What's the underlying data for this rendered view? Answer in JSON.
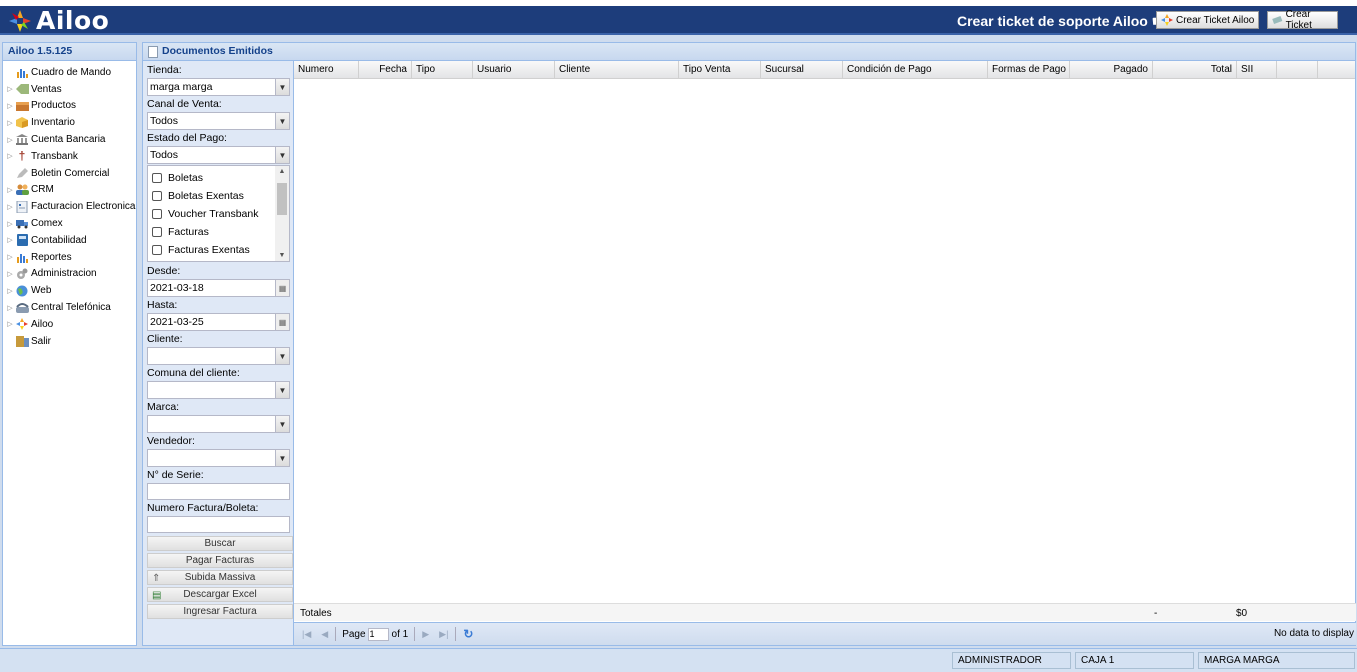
{
  "app": {
    "name": "Ailoo",
    "version_label": "Ailoo 1.5.125"
  },
  "header": {
    "support_text": "Crear ticket de soporte Ailoo ☛",
    "btn_ticket_ailoo": "Crear Ticket Ailoo",
    "btn_ticket": "Crear Ticket"
  },
  "sidebar": {
    "items": [
      {
        "label": "Cuadro de Mando",
        "icon": "bar-chart-icon",
        "expandable": false
      },
      {
        "label": "Ventas",
        "icon": "tag-icon",
        "expandable": true
      },
      {
        "label": "Productos",
        "icon": "box-icon",
        "expandable": true
      },
      {
        "label": "Inventario",
        "icon": "package-icon",
        "expandable": true
      },
      {
        "label": "Cuenta Bancaria",
        "icon": "bank-icon",
        "expandable": true
      },
      {
        "label": "Transbank",
        "icon": "cross-icon",
        "expandable": true
      },
      {
        "label": "Boletin Comercial",
        "icon": "pencil-icon",
        "expandable": false
      },
      {
        "label": "CRM",
        "icon": "users-icon",
        "expandable": true
      },
      {
        "label": "Facturacion Electronica",
        "icon": "document-icon",
        "expandable": true
      },
      {
        "label": "Comex",
        "icon": "truck-icon",
        "expandable": true
      },
      {
        "label": "Contabilidad",
        "icon": "calculator-icon",
        "expandable": true
      },
      {
        "label": "Reportes",
        "icon": "report-chart-icon",
        "expandable": true
      },
      {
        "label": "Administracion",
        "icon": "gears-icon",
        "expandable": true
      },
      {
        "label": "Web",
        "icon": "globe-icon",
        "expandable": true
      },
      {
        "label": "Central Telefónica",
        "icon": "phone-icon",
        "expandable": true
      },
      {
        "label": "Ailoo",
        "icon": "ailoo-logo-icon",
        "expandable": true
      },
      {
        "label": "Salir",
        "icon": "exit-door-icon",
        "expandable": false
      }
    ]
  },
  "documents": {
    "title": "Documentos Emitidos",
    "filters": {
      "tienda_label": "Tienda:",
      "tienda_value": "marga marga",
      "canal_label": "Canal de Venta:",
      "canal_value": "Todos",
      "estado_label": "Estado del Pago:",
      "estado_value": "Todos",
      "doc_types": [
        "Boletas",
        "Boletas Exentas",
        "Voucher Transbank",
        "Facturas",
        "Facturas Exentas"
      ],
      "desde_label": "Desde:",
      "desde_value": "2021-03-18",
      "hasta_label": "Hasta:",
      "hasta_value": "2021-03-25",
      "cliente_label": "Cliente:",
      "comuna_label": "Comuna del cliente:",
      "marca_label": "Marca:",
      "vendedor_label": "Vendedor:",
      "serie_label": "N° de Serie:",
      "numero_label": "Numero Factura/Boleta:"
    },
    "buttons": {
      "buscar": "Buscar",
      "pagar": "Pagar Facturas",
      "subida": "Subida Massiva",
      "excel": "Descargar Excel",
      "ingresar": "Ingresar Factura"
    },
    "columns": [
      "Numero",
      "Fecha",
      "Tipo",
      "Usuario",
      "Cliente",
      "Tipo Venta",
      "Sucursal",
      "Condición de Pago",
      "Formas de Pago",
      "Pagado",
      "Total",
      "SII"
    ],
    "totals": {
      "label": "Totales",
      "pagado": "-",
      "total": "$0"
    },
    "pager": {
      "page_label": "Page",
      "page_value": "1",
      "of_label": "of 1",
      "empty_text": "No data to display"
    }
  },
  "status": {
    "user": "ADMINISTRADOR",
    "caja": "CAJA 1",
    "store": "MARGA MARGA"
  }
}
